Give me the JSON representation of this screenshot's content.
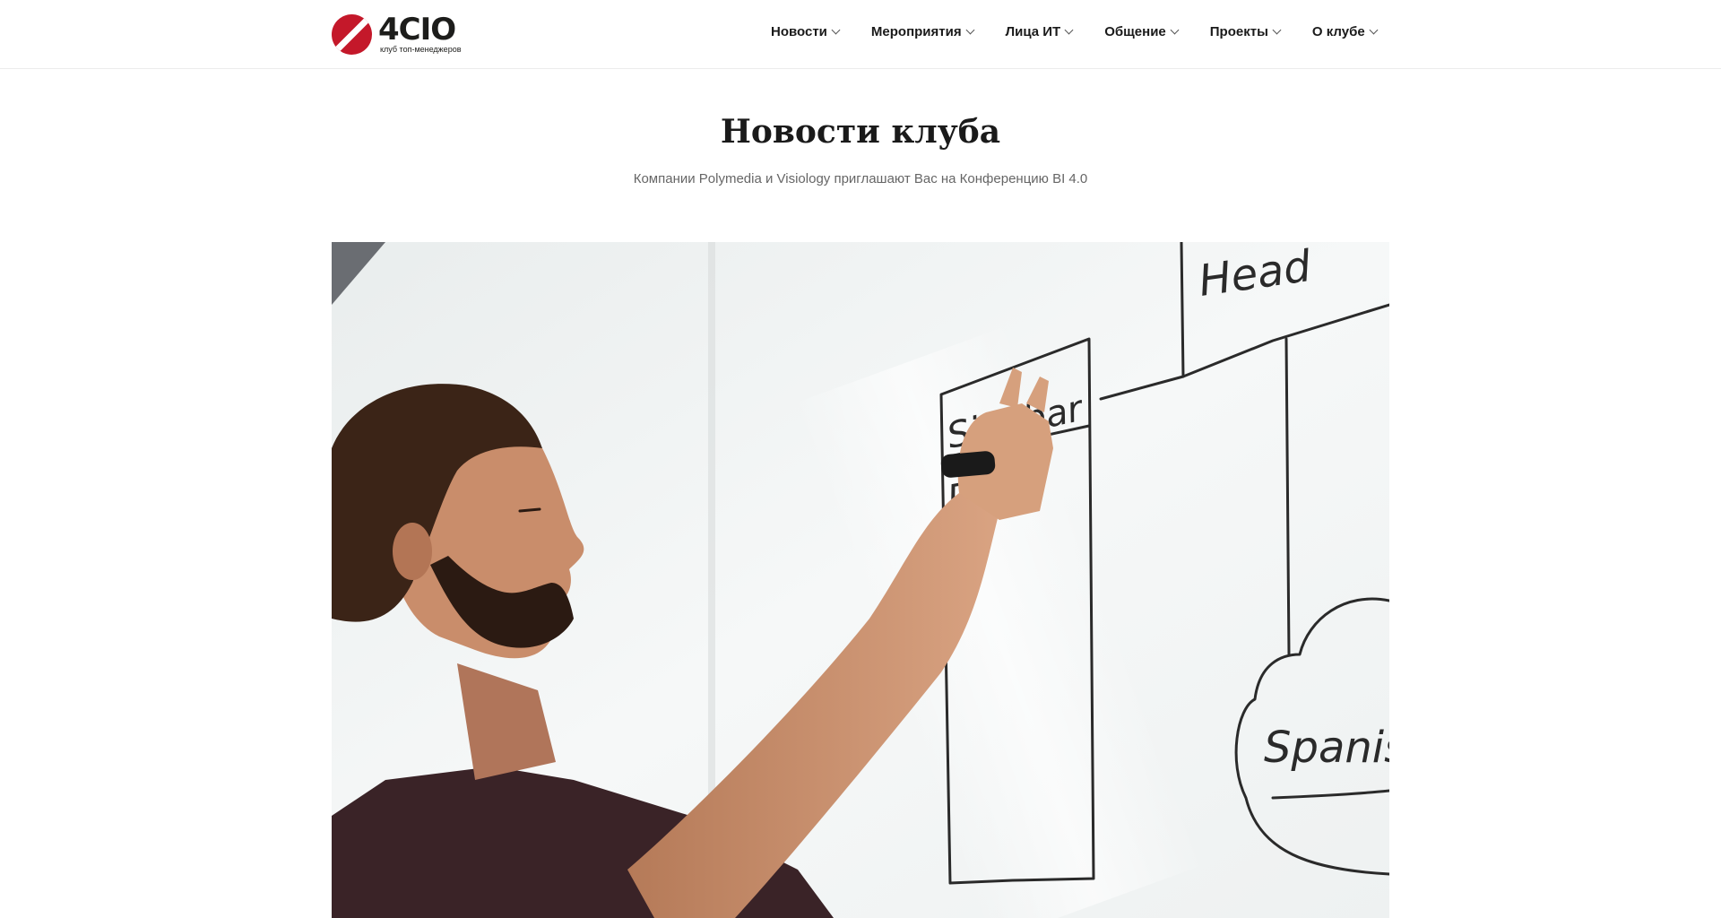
{
  "header": {
    "logo": {
      "name": "4CIO",
      "tagline": "клуб топ-менеджеров",
      "brand_color": "#c4182a"
    },
    "nav": [
      {
        "label": "Новости",
        "icon": "chevron-down-icon"
      },
      {
        "label": "Мероприятия",
        "icon": "chevron-down-icon"
      },
      {
        "label": "Лица ИТ",
        "icon": "chevron-down-icon"
      },
      {
        "label": "Общение",
        "icon": "chevron-down-icon"
      },
      {
        "label": "Проекты",
        "icon": "chevron-down-icon"
      },
      {
        "label": "О клубе",
        "icon": "chevron-down-icon"
      }
    ]
  },
  "main": {
    "title": "Новости клуба",
    "subtitle": "Компании Polymedia и Visiology приглашают Вас на Конференцию BI 4.0",
    "hero_image": {
      "whiteboard_text": {
        "sidebar": "Sidebar",
        "photo": "Pho",
        "header": "Head",
        "cloud": "Spanish"
      }
    }
  }
}
